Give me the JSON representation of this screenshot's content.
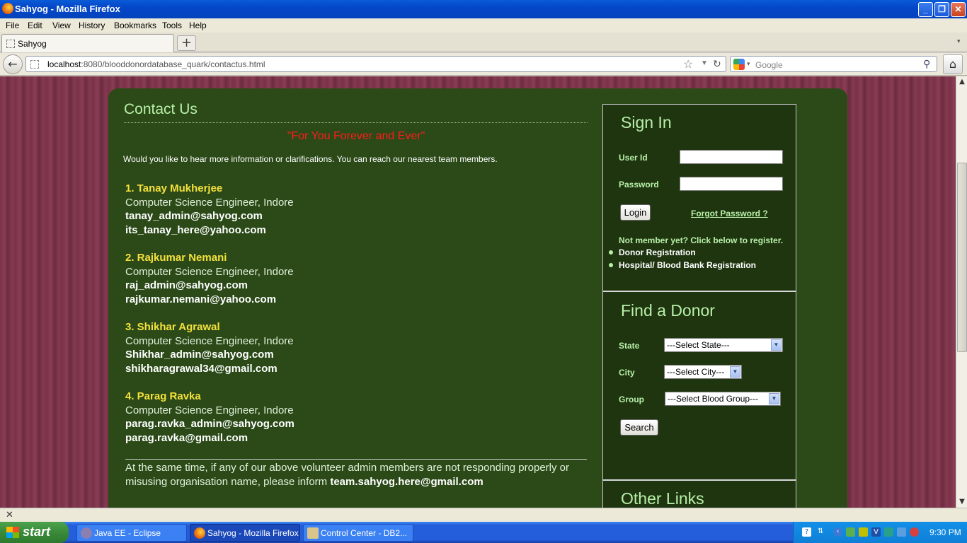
{
  "window": {
    "title": "Sahyog - Mozilla Firefox"
  },
  "menu": [
    "File",
    "Edit",
    "View",
    "History",
    "Bookmarks",
    "Tools",
    "Help"
  ],
  "tab": {
    "label": "Sahyog",
    "new_tab": "+"
  },
  "nav": {
    "url_host": "localhost",
    "url_rest": ":8080/blooddonordatabase_quark/contactus.html",
    "search_placeholder": "Google"
  },
  "page": {
    "heading": "Contact Us",
    "tagline": "\"For You Forever and Ever\"",
    "intro": "Would you like to hear more information or clarifications. You can reach our nearest team members.",
    "members": [
      {
        "name": "1. Tanay Mukherjee",
        "role": "Computer Science Engineer, Indore",
        "email1": "tanay_admin@sahyog.com",
        "email2": "its_tanay_here@yahoo.com"
      },
      {
        "name": "2. Rajkumar Nemani",
        "role": "Computer Science Engineer, Indore",
        "email1": "raj_admin@sahyog.com",
        "email2": "rajkumar.nemani@yahoo.com"
      },
      {
        "name": "3. Shikhar Agrawal",
        "role": "Computer Science Engineer, Indore",
        "email1": "Shikhar_admin@sahyog.com",
        "email2": "shikharagrawal34@gmail.com"
      },
      {
        "name": "4. Parag Ravka",
        "role": "Computer Science Engineer, Indore",
        "email1": "parag.ravka_admin@sahyog.com",
        "email2": "parag.ravka@gmail.com"
      }
    ],
    "footer_text": "At the same time, if any of our above volunteer admin members are not responding properly or misusing organisation name, please inform ",
    "footer_email": "team.sahyog.here@gmail.com"
  },
  "signin": {
    "heading": "Sign In",
    "userid_label": "User Id",
    "password_label": "Password",
    "login_button": "Login",
    "forgot_link": "Forgot Password ?",
    "not_member": "Not member yet? Click below to register.",
    "donor_reg": "Donor Registration",
    "hospital_reg": "Hospital/ Blood Bank Registration"
  },
  "find_donor": {
    "heading": "Find a Donor",
    "state_label": "State",
    "state_value": "---Select State---",
    "city_label": "City",
    "city_value": "---Select City---",
    "group_label": "Group",
    "group_value": "---Select Blood Group---",
    "search_button": "Search"
  },
  "other_links": {
    "heading": "Other Links"
  },
  "taskbar": {
    "start": "start",
    "tasks": [
      "Java EE - Eclipse",
      "Sahyog - Mozilla Firefox",
      "Control Center - DB2..."
    ],
    "clock": "9:30 PM"
  },
  "colors": {
    "panel": "#2b4a18",
    "accent": "#b8f0a8",
    "tagline": "#ff1b1b",
    "member_name": "#f5e13c"
  }
}
